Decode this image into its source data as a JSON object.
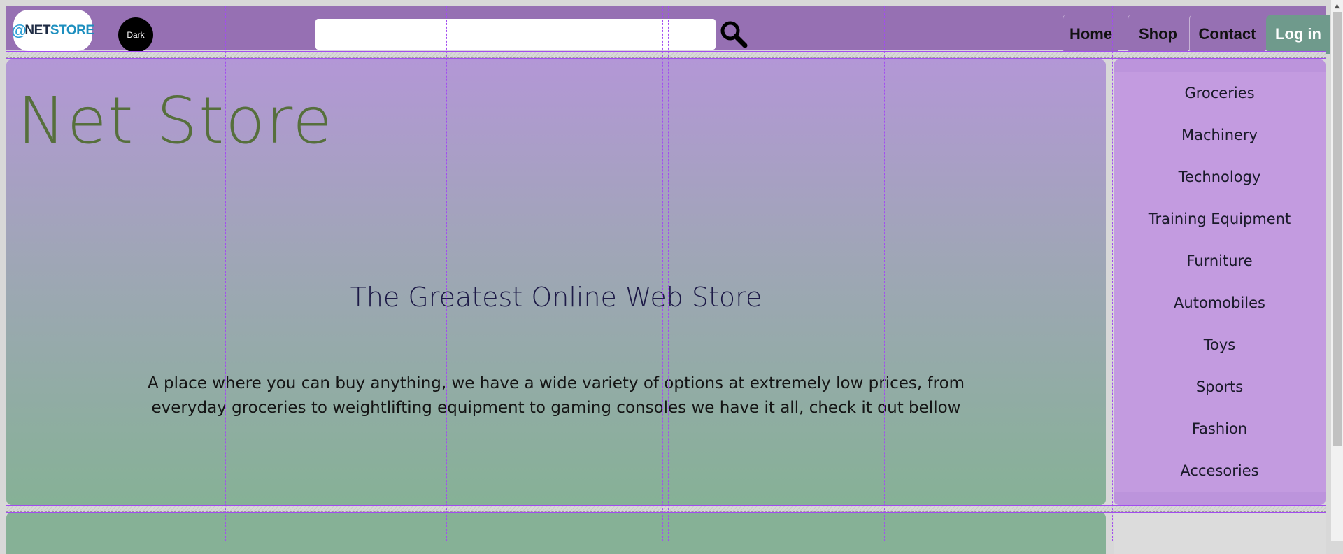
{
  "header": {
    "logo_text_at": "@",
    "logo_text_net": "NET",
    "logo_text_store": "STORE",
    "dark_toggle": "Dark",
    "search": {
      "placeholder": "",
      "value": ""
    },
    "nav": {
      "home": "Home",
      "shop": "Shop",
      "contact": "Contact",
      "login": "Log in"
    }
  },
  "hero": {
    "title": "Net Store",
    "subtitle": "The Greatest Online Web Store",
    "description": "A place where you can buy anything, we have a wide variety of options at extremely low prices, from everyday groceries to weightlifting equipment to gaming consoles we have it all, check it out bellow"
  },
  "sidebar": {
    "categories": [
      "Groceries",
      "Machinery",
      "Technology",
      "Training Equipment",
      "Furniture",
      "Automobiles",
      "Toys",
      "Sports",
      "Fashion",
      "Accesories"
    ]
  },
  "colors": {
    "header": "#9670b3",
    "login_button": "#6f9a8c",
    "hero_top": "#b397d6",
    "hero_bottom": "#86b196",
    "sidebar": "#bc94dc",
    "grid_overlay": "#a24cf0"
  },
  "icons": {
    "search": "magnifier-icon",
    "scroll_up": "triangle-up-icon"
  }
}
